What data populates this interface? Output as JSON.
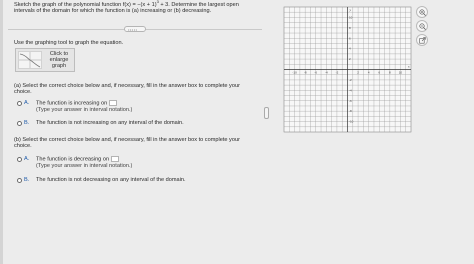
{
  "question": {
    "prefix": "Sketch the graph of the polynomial function f(x) = −(x + 1)",
    "exponent": "3",
    "suffix": " + 3. Determine the largest open intervals of the domain for which the function is (a) increasing or (b) decreasing."
  },
  "instruction": "Use the graphing tool to graph the equation.",
  "graph_tool": {
    "label": "Click to enlarge graph",
    "icon": "graph-thumbnail-icon"
  },
  "part_a": {
    "prompt": "(a) Select the correct choice below and, if necessary, fill in the answer box to complete your choice.",
    "choices": [
      {
        "letter": "A.",
        "text": "The function is increasing on",
        "note": "(Type your answer in interval notation.)"
      },
      {
        "letter": "B.",
        "text": "The function is not increasing on any interval of the domain."
      }
    ]
  },
  "part_b": {
    "prompt": "(b) Select the correct choice below and, if necessary, fill in the answer box to complete your choice.",
    "choices": [
      {
        "letter": "A.",
        "text": "The function is decreasing on",
        "note": "(Type your answer in interval notation.)"
      },
      {
        "letter": "B.",
        "text": "The function is not decreasing on any interval of the domain."
      }
    ]
  },
  "graph": {
    "x_axis_label": "x",
    "y_axis_label": "y",
    "x_ticks": [
      "-10",
      "-8",
      "-6",
      "-4",
      "-2",
      "2",
      "4",
      "6",
      "8",
      "10"
    ],
    "y_ticks": [
      "10",
      "8",
      "6",
      "4",
      "2",
      "-2",
      "-4",
      "-6",
      "-8",
      "-10"
    ]
  },
  "graph_tools": {
    "zoom_in": "zoom-in-icon",
    "zoom_out": "zoom-out-icon",
    "external": "external-link-icon"
  },
  "colors": {
    "choice_letter": "#1e5aa8",
    "panel_background": "#ececec",
    "grid_line": "#9a9a9a",
    "axis_line": "#333333"
  }
}
